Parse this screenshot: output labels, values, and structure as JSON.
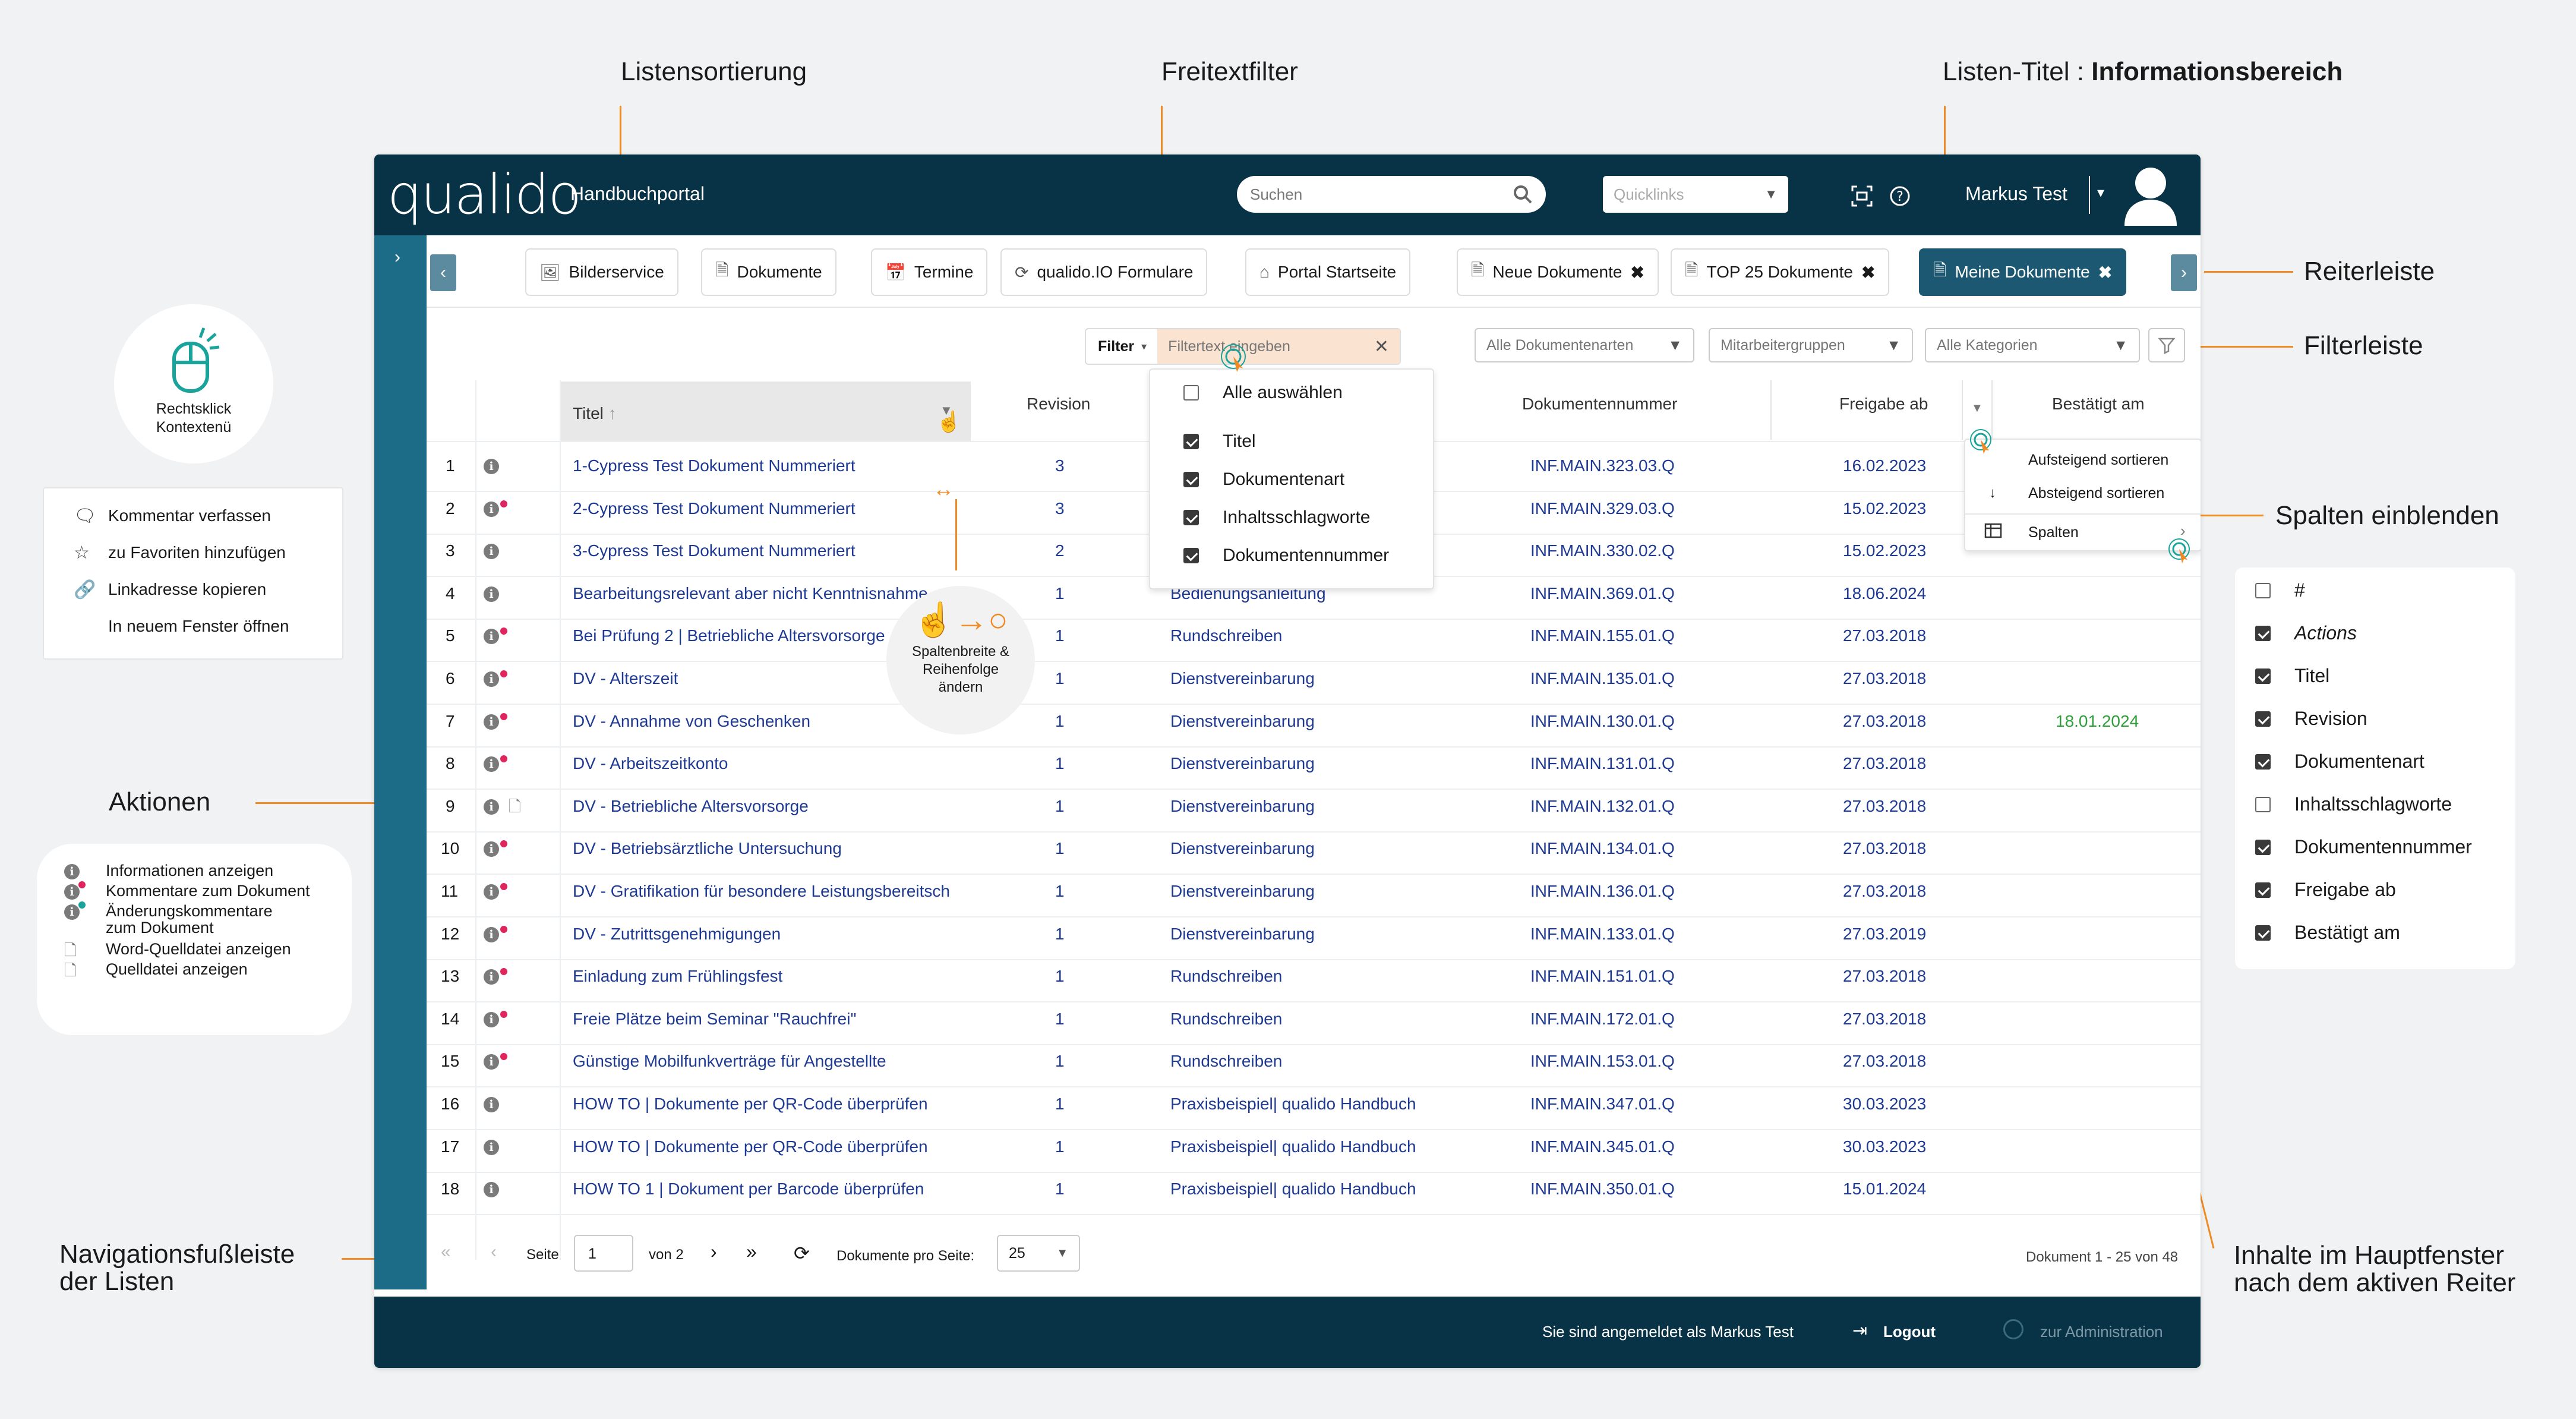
{
  "annotations": {
    "listensortierung": "Listensortierung",
    "freitextfilter": "Freitextfilter",
    "listen_titel_prefix": "Listen-Titel : ",
    "listen_titel_bold": "Informationsbereich",
    "reiterleiste": "Reiterleiste",
    "filterleiste": "Filterleiste",
    "spalten_einblenden": "Spalten einblenden",
    "aktionen": "Aktionen",
    "navigationsfussleiste_1": "Navigationsfußleiste",
    "navigationsfussleiste_2": "der Listen",
    "inhalte_1": "Inhalte im Hauptfenster",
    "inhalte_2": "nach dem aktiven Reiter",
    "rechtsklick_1": "Rechtsklick",
    "rechtsklick_2": "Kontextenü",
    "spaltenbreite_1": "Spaltenbreite &",
    "spaltenbreite_2": "Reihenfolge",
    "spaltenbreite_3": "ändern"
  },
  "context_menu": [
    {
      "icon": "comment-icon",
      "label": "Kommentar verfassen"
    },
    {
      "icon": "star-icon",
      "label": "zu Favoriten hinzufügen"
    },
    {
      "icon": "link-icon",
      "label": "Linkadresse kopieren"
    },
    {
      "icon": "",
      "label": "In neuem Fenster öffnen"
    }
  ],
  "legend": [
    {
      "icon": "info-icon",
      "label": "Informationen anzeigen"
    },
    {
      "icon": "info-comment-icon",
      "label": "Kommentare  zum Dokument"
    },
    {
      "icon": "info-change-icon",
      "label": "Änderungskommentare"
    },
    {
      "icon": "",
      "label": "zum Dokument"
    },
    {
      "icon": "word-doc-icon",
      "label": "Word-Quelldatei anzeigen"
    },
    {
      "icon": "file-icon",
      "label": "Quelldatei anzeigen"
    }
  ],
  "column_chooser": [
    {
      "label": "#",
      "checked": false,
      "italic": false
    },
    {
      "label": "Actions",
      "checked": true,
      "italic": true
    },
    {
      "label": "Titel",
      "checked": true,
      "italic": false
    },
    {
      "label": "Revision",
      "checked": true,
      "italic": false
    },
    {
      "label": "Dokumentenart",
      "checked": true,
      "italic": false
    },
    {
      "label": "Inhaltsschlagworte",
      "checked": false,
      "italic": false
    },
    {
      "label": "Dokumentennummer",
      "checked": true,
      "italic": false
    },
    {
      "label": "Freigabe ab",
      "checked": true,
      "italic": false
    },
    {
      "label": "Bestätigt am",
      "checked": true,
      "italic": false
    }
  ],
  "app": {
    "logo": "qualido",
    "portal_name": "Handbuchportal",
    "search_placeholder": "Suchen",
    "quicklinks_placeholder": "Quicklinks",
    "user_name": "Markus Test"
  },
  "tabs": [
    {
      "icon": "image-icon",
      "label": "Bilderservice",
      "closable": false
    },
    {
      "icon": "document-icon",
      "label": "Dokumente",
      "closable": false
    },
    {
      "icon": "calendar-icon",
      "label": "Termine",
      "closable": false
    },
    {
      "icon": "refresh-icon",
      "label": "qualido.IO Formulare",
      "closable": false
    },
    {
      "icon": "home-icon",
      "label": "Portal Startseite",
      "closable": false
    },
    {
      "icon": "document-icon",
      "label": "Neue Dokumente",
      "closable": true
    },
    {
      "icon": "document-icon",
      "label": "TOP 25 Dokumente",
      "closable": true
    },
    {
      "icon": "document-icon",
      "label": "Meine Dokumente",
      "closable": true,
      "active": true
    }
  ],
  "filterbar": {
    "filter_label": "Filter",
    "filter_placeholder": "Filtertext eingeben",
    "doc_types": "Alle Dokumentenarten",
    "employee_groups": "Mitarbeitergruppen",
    "categories": "Alle Kategorien"
  },
  "filter_dropdown": {
    "select_all": "Alle auswählen",
    "items": [
      {
        "label": "Titel",
        "checked": true
      },
      {
        "label": "Dokumentenart",
        "checked": true
      },
      {
        "label": "Inhaltsschlagworte",
        "checked": true
      },
      {
        "label": "Dokumentennummer",
        "checked": true
      }
    ]
  },
  "sort_menu": {
    "asc": "Aufsteigend sortieren",
    "desc": "Absteigend sortieren",
    "columns": "Spalten"
  },
  "columns": {
    "title": "Titel",
    "revision": "Revision",
    "docnumber": "Dokumentennummer",
    "release": "Freigabe ab",
    "confirmed": "Bestätigt am"
  },
  "rows": [
    {
      "n": "1",
      "title": "1-Cypress Test Dokument Nummeriert",
      "rev": "3",
      "type": "",
      "num": "INF.MAIN.323.03.Q",
      "rel": "16.02.2023",
      "conf": "",
      "comment": false,
      "word": false
    },
    {
      "n": "2",
      "title": "2-Cypress Test Dokument Nummeriert",
      "rev": "3",
      "type": "",
      "num": "INF.MAIN.329.03.Q",
      "rel": "15.02.2023",
      "conf": "",
      "comment": true,
      "word": false
    },
    {
      "n": "3",
      "title": "3-Cypress Test Dokument Nummeriert",
      "rev": "2",
      "type": "",
      "num": "INF.MAIN.330.02.Q",
      "rel": "15.02.2023",
      "conf": "",
      "comment": false,
      "word": false
    },
    {
      "n": "4",
      "title": "Bearbeitungsrelevant aber nicht Kenntnisnahme",
      "rev": "1",
      "type": "Bedienungsanleitung",
      "num": "INF.MAIN.369.01.Q",
      "rel": "18.06.2024",
      "conf": "",
      "comment": false,
      "word": false
    },
    {
      "n": "5",
      "title": "Bei Prüfung 2 | Betriebliche Altersvorsorge",
      "rev": "1",
      "type": "Rundschreiben",
      "num": "INF.MAIN.155.01.Q",
      "rel": "27.03.2018",
      "conf": "",
      "comment": true,
      "word": false
    },
    {
      "n": "6",
      "title": "DV - Alterszeit",
      "rev": "1",
      "type": "Dienstvereinbarung",
      "num": "INF.MAIN.135.01.Q",
      "rel": "27.03.2018",
      "conf": "",
      "comment": true,
      "word": false
    },
    {
      "n": "7",
      "title": "DV - Annahme von Geschenken",
      "rev": "1",
      "type": "Dienstvereinbarung",
      "num": "INF.MAIN.130.01.Q",
      "rel": "27.03.2018",
      "conf": "18.01.2024",
      "comment": true,
      "word": false
    },
    {
      "n": "8",
      "title": "DV - Arbeitszeitkonto",
      "rev": "1",
      "type": "Dienstvereinbarung",
      "num": "INF.MAIN.131.01.Q",
      "rel": "27.03.2018",
      "conf": "",
      "comment": true,
      "word": false
    },
    {
      "n": "9",
      "title": "DV - Betriebliche Altersvorsorge",
      "rev": "1",
      "type": "Dienstvereinbarung",
      "num": "INF.MAIN.132.01.Q",
      "rel": "27.03.2018",
      "conf": "",
      "comment": false,
      "word": true
    },
    {
      "n": "10",
      "title": "DV - Betriebsärztliche Untersuchung",
      "rev": "1",
      "type": "Dienstvereinbarung",
      "num": "INF.MAIN.134.01.Q",
      "rel": "27.03.2018",
      "conf": "",
      "comment": true,
      "word": false
    },
    {
      "n": "11",
      "title": "DV - Gratifikation für besondere Leistungsbereitsch",
      "rev": "1",
      "type": "Dienstvereinbarung",
      "num": "INF.MAIN.136.01.Q",
      "rel": "27.03.2018",
      "conf": "",
      "comment": true,
      "word": false
    },
    {
      "n": "12",
      "title": "DV - Zutrittsgenehmigungen",
      "rev": "1",
      "type": "Dienstvereinbarung",
      "num": "INF.MAIN.133.01.Q",
      "rel": "27.03.2019",
      "conf": "",
      "comment": true,
      "word": false
    },
    {
      "n": "13",
      "title": "Einladung zum Frühlingsfest",
      "rev": "1",
      "type": "Rundschreiben",
      "num": "INF.MAIN.151.01.Q",
      "rel": "27.03.2018",
      "conf": "",
      "comment": true,
      "word": false
    },
    {
      "n": "14",
      "title": "Freie Plätze beim Seminar \"Rauchfrei\"",
      "rev": "1",
      "type": "Rundschreiben",
      "num": "INF.MAIN.172.01.Q",
      "rel": "27.03.2018",
      "conf": "",
      "comment": true,
      "word": false
    },
    {
      "n": "15",
      "title": "Günstige Mobilfunkverträge für Angestellte",
      "rev": "1",
      "type": "Rundschreiben",
      "num": "INF.MAIN.153.01.Q",
      "rel": "27.03.2018",
      "conf": "",
      "comment": true,
      "word": false
    },
    {
      "n": "16",
      "title": "HOW TO | Dokumente per QR-Code überprüfen",
      "rev": "1",
      "type": "Praxisbeispiel| qualido Handbuch",
      "num": "INF.MAIN.347.01.Q",
      "rel": "30.03.2023",
      "conf": "",
      "comment": false,
      "word": false
    },
    {
      "n": "17",
      "title": "HOW TO | Dokumente per QR-Code überprüfen",
      "rev": "1",
      "type": "Praxisbeispiel| qualido Handbuch",
      "num": "INF.MAIN.345.01.Q",
      "rel": "30.03.2023",
      "conf": "",
      "comment": false,
      "word": false
    },
    {
      "n": "18",
      "title": "HOW TO 1 | Dokument per Barcode überprüfen",
      "rev": "1",
      "type": "Praxisbeispiel| qualido Handbuch",
      "num": "INF.MAIN.350.01.Q",
      "rel": "15.01.2024",
      "conf": "",
      "comment": false,
      "word": false
    }
  ],
  "pager": {
    "page_label": "Seite",
    "page_value": "1",
    "of_label": "von 2",
    "per_page_label": "Dokumente pro Seite:",
    "per_page_value": "25",
    "summary": "Dokument 1 - 25 von 48"
  },
  "footer": {
    "logged_in": "Sie sind angemeldet als Markus Test",
    "logout": "Logout",
    "admin": "zur Administration"
  },
  "colors": {
    "navy": "#083347",
    "teal": "#1c6c87",
    "accent": "#f08a24",
    "link_blue": "#1f3a93",
    "green": "#2e9e3a",
    "badge_red": "#e0245e"
  }
}
